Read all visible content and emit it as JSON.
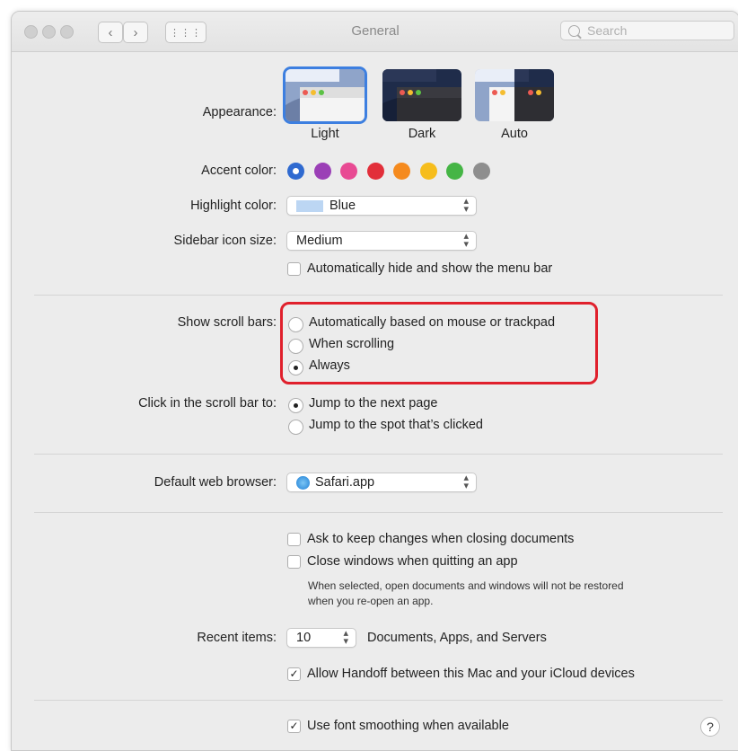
{
  "window": {
    "title": "General",
    "search_placeholder": "Search"
  },
  "appearance": {
    "label": "Appearance:",
    "options": [
      "Light",
      "Dark",
      "Auto"
    ],
    "selected": "Light"
  },
  "accent": {
    "label": "Accent color:",
    "colors": [
      "#2f6ad0",
      "#9b3fb6",
      "#e84a93",
      "#e22f3a",
      "#f58a1e",
      "#f6bd1c",
      "#45b545",
      "#8e8e8e"
    ],
    "selected_index": 0
  },
  "highlight": {
    "label": "Highlight color:",
    "value": "Blue",
    "swatch_color": "#bcd6f3"
  },
  "sidebar_size": {
    "label": "Sidebar icon size:",
    "value": "Medium"
  },
  "menubar": {
    "label": "Automatically hide and show the menu bar",
    "checked": false
  },
  "scrollbars": {
    "label": "Show scroll bars:",
    "options": [
      "Automatically based on mouse or trackpad",
      "When scrolling",
      "Always"
    ],
    "selected": "Always"
  },
  "click_scroll": {
    "label": "Click in the scroll bar to:",
    "options": [
      "Jump to the next page",
      "Jump to the spot that’s clicked"
    ],
    "selected": "Jump to the next page"
  },
  "browser": {
    "label": "Default web browser:",
    "value": "Safari.app"
  },
  "documents": {
    "ask_keep": "Ask to keep changes when closing documents",
    "close_windows": "Close windows when quitting an app",
    "note_line1": "When selected, open documents and windows will not be restored",
    "note_line2": "when you re-open an app."
  },
  "recent": {
    "label": "Recent items:",
    "value": "10",
    "suffix": "Documents, Apps, and Servers"
  },
  "handoff": {
    "label": "Allow Handoff between this Mac and your iCloud devices",
    "checked": true
  },
  "smoothing": {
    "label": "Use font smoothing when available",
    "checked": true
  },
  "help": "?"
}
